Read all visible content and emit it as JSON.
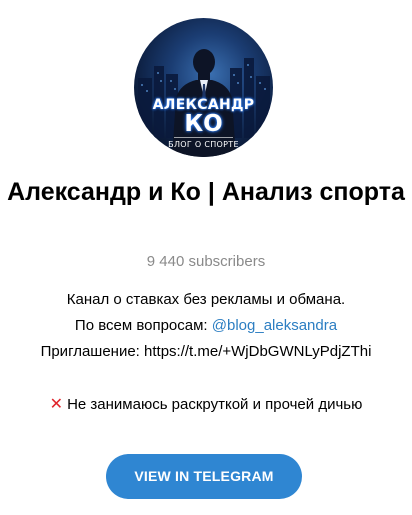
{
  "channel": {
    "avatar": {
      "name_line1": "АЛЕКСАНДР",
      "name_line2": "КО",
      "tagline": "БЛОГ О СПОРТЕ"
    },
    "title": "Александр и Ко | Анализ спорта",
    "subscribers": "9 440 subscribers",
    "description": {
      "line1": "Канал о ставках без рекламы и обмана.",
      "line2_prefix": "По всем вопросам: ",
      "line2_link": "@blog_aleksandra",
      "line3": "Приглашение: https://t.me/+WjDbGWNLyPdjZThi",
      "line4_icon": "cross-mark-icon",
      "line4": "Не занимаюсь раскруткой и прочей дичью"
    }
  },
  "button": {
    "label": "VIEW IN TELEGRAM"
  },
  "colors": {
    "link": "#2c7ec2",
    "button": "#2f86d2",
    "muted": "#8a8a8a",
    "cross": "#e0242b"
  }
}
